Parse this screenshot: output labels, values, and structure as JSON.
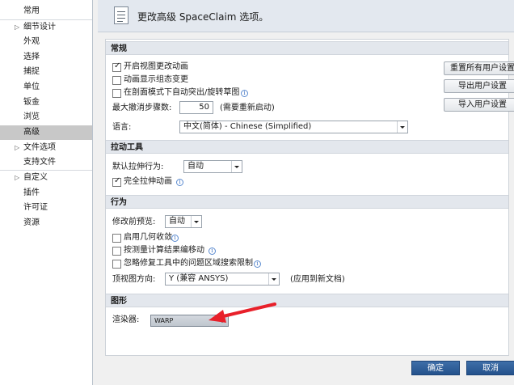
{
  "nav": {
    "items": [
      {
        "label": "常用",
        "expandable": false
      },
      {
        "label": "细节设计",
        "expandable": true
      },
      {
        "label": "外观",
        "expandable": false
      },
      {
        "label": "选择",
        "expandable": false
      },
      {
        "label": "捕捉",
        "expandable": false
      },
      {
        "label": "单位",
        "expandable": false
      },
      {
        "label": "钣金",
        "expandable": false
      },
      {
        "label": "浏览",
        "expandable": false
      },
      {
        "label": "高级",
        "expandable": false,
        "selected": true
      },
      {
        "label": "文件选项",
        "expandable": true
      },
      {
        "label": "支持文件",
        "expandable": false
      },
      {
        "label": "自定义",
        "expandable": true
      },
      {
        "label": "插件",
        "expandable": false
      },
      {
        "label": "许可证",
        "expandable": false
      },
      {
        "label": "资源",
        "expandable": false
      }
    ]
  },
  "header": {
    "title": "更改高级 SpaceClaim 选项。"
  },
  "sections": {
    "general": {
      "title": "常规",
      "cb_view_anim": "开启视图更改动画",
      "cb_state_anim": "动画显示组态变更",
      "cb_auto_sketch": "在剖面模式下自动突出/旋转草图",
      "max_undo_label": "最大撤消步骤数:",
      "max_undo_value": "50",
      "max_undo_note": "(需要重新启动)",
      "language_label": "语言:",
      "language_value": "中文(简体) - Chinese (Simplified)"
    },
    "pull": {
      "title": "拉动工具",
      "default_label": "默认拉伸行为:",
      "default_value": "自动",
      "cb_full_anim": "完全拉伸动画"
    },
    "behavior": {
      "title": "行为",
      "preview_label": "修改前预览:",
      "preview_value": "自动",
      "cb_geo_converge": "启用几何收敛",
      "cb_move_by_result": "按测量计算结果编移动",
      "cb_ignore_limit": "忽略修复工具中的问题区域搜索限制",
      "top_view_label": "顶视图方向:",
      "top_view_value": "Y (兼容 ANSYS)",
      "top_view_note": "(应用到新文档)"
    },
    "graphics": {
      "title": "图形",
      "renderer_label": "渲染器:",
      "renderer_value": "WARP"
    }
  },
  "side_buttons": {
    "reset": "重置所有用户设置",
    "export": "导出用户设置",
    "import": "导入用户设置"
  },
  "footer": {
    "ok": "确定",
    "cancel": "取消"
  },
  "states": {
    "cb_view_anim": true,
    "cb_state_anim": false,
    "cb_auto_sketch": false,
    "cb_full_anim": true,
    "cb_geo_converge": false,
    "cb_move_by_result": false,
    "cb_ignore_limit": false
  },
  "colors": {
    "accent_button": "#2f5f9a",
    "arrow": "#e8202a",
    "selected_nav": "#c8c8c8"
  },
  "icons": [
    "document-icon",
    "info-icon",
    "chevron-down-icon",
    "expand-icon",
    "checkbox-checked"
  ]
}
